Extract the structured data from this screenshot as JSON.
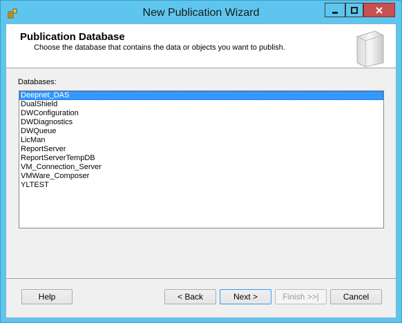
{
  "window": {
    "title": "New Publication Wizard"
  },
  "header": {
    "title": "Publication Database",
    "subtitle": "Choose the database that contains the data or objects you want to publish."
  },
  "databases": {
    "label": "Databases:",
    "selected": "Deepnet_DAS",
    "items": [
      "Deepnet_DAS",
      "DualShield",
      "DWConfiguration",
      "DWDiagnostics",
      "DWQueue",
      "LicMan",
      "ReportServer",
      "ReportServerTempDB",
      "VM_Connection_Server",
      "VMWare_Composer",
      "YLTEST"
    ]
  },
  "buttons": {
    "help": "Help",
    "back": "< Back",
    "next": "Next >",
    "finish": "Finish >>|",
    "cancel": "Cancel"
  },
  "colors": {
    "titlebar": "#5ec6ee",
    "selection": "#3399ff",
    "close": "#c75050"
  }
}
